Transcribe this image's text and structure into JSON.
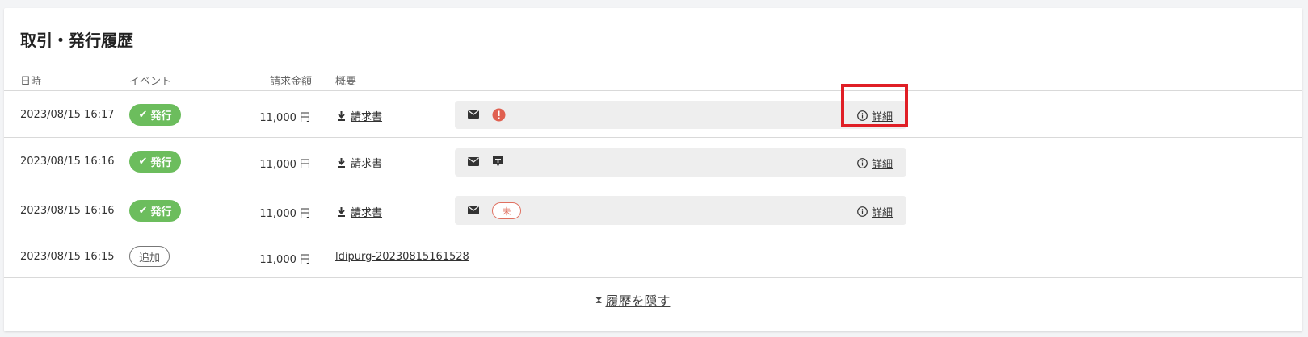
{
  "section": {
    "title": "取引・発行履歴"
  },
  "headers": {
    "date": "日時",
    "event": "イベント",
    "amount": "請求金額",
    "summary": "概要"
  },
  "rows": [
    {
      "date": "2023/08/15 16:17",
      "event": "発行",
      "amount": "11,000 円",
      "link": "請求書",
      "status": "error-icon",
      "detail": "詳細"
    },
    {
      "date": "2023/08/15 16:16",
      "event": "発行",
      "amount": "11,000 円",
      "link": "請求書",
      "status": "message-icon",
      "detail": "詳細"
    },
    {
      "date": "2023/08/15 16:16",
      "event": "発行",
      "amount": "11,000 円",
      "link": "請求書",
      "status": "unsent",
      "unsent_label": "未",
      "detail": "詳細"
    },
    {
      "date": "2023/08/15 16:15",
      "event": "追加",
      "amount": "11,000 円",
      "link": "ldipurg-20230815161528"
    }
  ],
  "footer": {
    "hide_label": "履歴を隠す"
  },
  "colors": {
    "issue_badge": "#6cbd5d",
    "error": "#e06050",
    "highlight": "#e01f26"
  }
}
